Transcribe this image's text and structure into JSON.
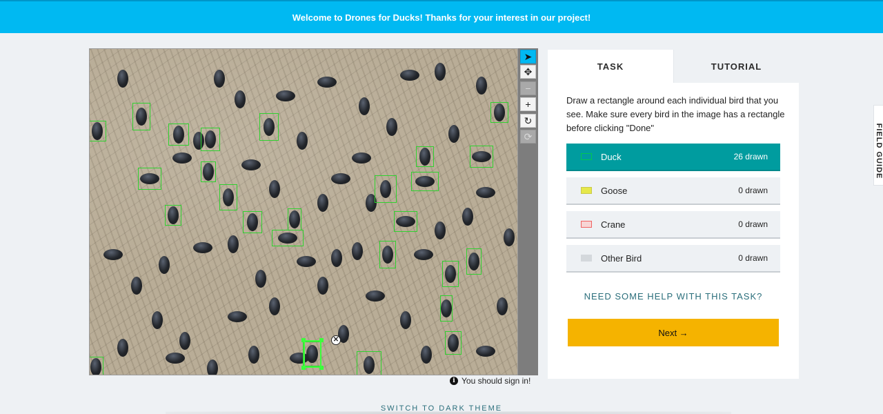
{
  "banner": {
    "text": "Welcome to Drones for Ducks! Thanks for your interest in our project!"
  },
  "toolbar": {
    "tools": [
      {
        "name": "pointer-icon",
        "glyph": "➤"
      },
      {
        "name": "move-icon",
        "glyph": "✥"
      },
      {
        "name": "zoom-out-icon",
        "glyph": "−"
      },
      {
        "name": "zoom-in-icon",
        "glyph": "+"
      },
      {
        "name": "rotate-icon",
        "glyph": "↻"
      },
      {
        "name": "reset-icon",
        "glyph": "⟳"
      }
    ]
  },
  "subject": {
    "delete_glyph": "✕"
  },
  "signin": {
    "icon_glyph": "i",
    "text": "You should sign in!"
  },
  "tabs": {
    "task": "TASK",
    "tutorial": "TUTORIAL"
  },
  "instructions": "Draw a rectangle around each individual bird that you see. Make sure every bird in the image has a rectangle before clicking \"Done\"",
  "tools": [
    {
      "label": "Duck",
      "count": "26 drawn",
      "color": "#00c853",
      "active": true
    },
    {
      "label": "Goose",
      "count": "0 drawn",
      "color": "#e6e84a",
      "active": false
    },
    {
      "label": "Crane",
      "count": "0 drawn",
      "color": "#f06262",
      "active": false
    },
    {
      "label": "Other Bird",
      "count": "0 drawn",
      "color": "#d4d8dc",
      "active": false
    }
  ],
  "help_link": "NEED SOME HELP WITH THIS TASK?",
  "next_button": "Next →",
  "field_guide": "FIELD GUIDE",
  "footer": {
    "dark_theme": "SWITCH TO DARK THEME"
  },
  "colors": {
    "banner": "#00b9f2",
    "accent_teal": "#009c9f",
    "next_button": "#f5b300",
    "box_green": "#2fd12f",
    "link": "#2a6e7b"
  }
}
